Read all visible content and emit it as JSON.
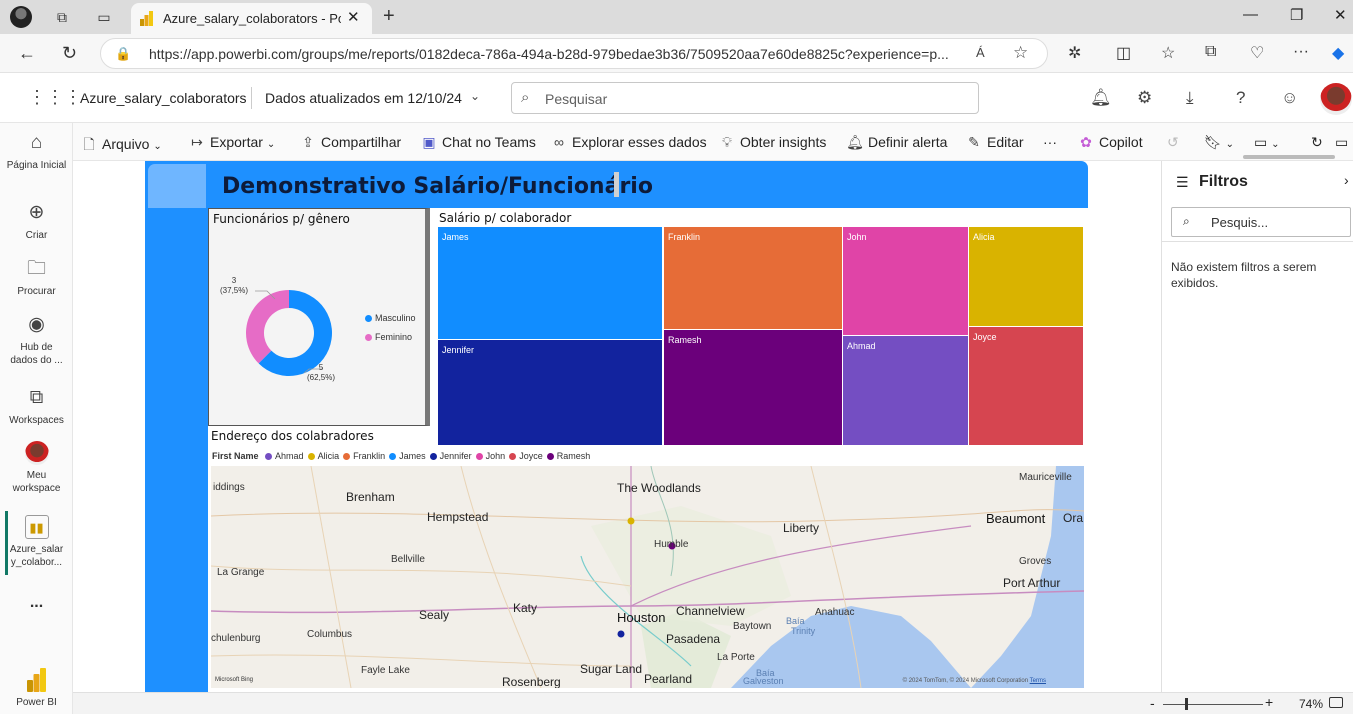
{
  "browser": {
    "tab_title": "Azure_salary_colaborators - Power BI",
    "url": "https://app.powerbi.com/groups/me/reports/0182deca-786a-494a-b28d-979bedae3b36/7509520aa7e60de8825c?experience=p...",
    "read_aloud": "Á"
  },
  "header": {
    "workspace_name": "Azure_salary_colaborators",
    "updated": "Dados atualizados em 12/10/24",
    "search_placeholder": "Pesquisar"
  },
  "leftnav": {
    "items": [
      {
        "label": "Página Inicial"
      },
      {
        "label": "Criar"
      },
      {
        "label": "Procurar"
      },
      {
        "label": "Hub de dados do ..."
      },
      {
        "label": "Workspaces"
      },
      {
        "label": "Meu workspace"
      },
      {
        "label": "Azure_salar y_colabor..."
      },
      {
        "label": "..."
      }
    ],
    "powerbi_label": "Power BI"
  },
  "toolbar": {
    "arquivo": "Arquivo",
    "exportar": "Exportar",
    "compartilhar": "Compartilhar",
    "chat_teams": "Chat no Teams",
    "explorar": "Explorar esses dados",
    "insights": "Obter insights",
    "alerta": "Definir alerta",
    "editar": "Editar",
    "more": "···",
    "copilot": "Copilot"
  },
  "report": {
    "title": "Demonstrativo Salário/Funcionário",
    "donut_title": "Funcionários p/ gênero",
    "treemap_title": "Salário p/ colaborador",
    "map_title": "Endereço dos colabradores",
    "map_legend_label": "First Name"
  },
  "chart_data": [
    {
      "type": "pie",
      "title": "Funcionários p/ gênero",
      "categories": [
        "Masculino",
        "Feminino"
      ],
      "values": [
        5,
        3
      ],
      "percent_labels": [
        "(62,5%)",
        "(37,5%)"
      ],
      "colors": [
        "#118dff",
        "#e66cc6"
      ],
      "legend": "right"
    },
    {
      "type": "treemap",
      "title": "Salário p/ colaborador",
      "categories": [
        "James",
        "Jennifer",
        "Franklin",
        "Ramesh",
        "John",
        "Ahmad",
        "Alicia",
        "Joyce"
      ],
      "colors": [
        "#118dff",
        "#12239e",
        "#e66c37",
        "#6b007b",
        "#e044a7",
        "#744ec2",
        "#d9b300",
        "#d64550"
      ]
    }
  ],
  "map": {
    "legend": [
      {
        "name": "Ahmad",
        "color": "#744ec2"
      },
      {
        "name": "Alicia",
        "color": "#d9b300"
      },
      {
        "name": "Franklin",
        "color": "#e66c37"
      },
      {
        "name": "James",
        "color": "#118dff"
      },
      {
        "name": "Jennifer",
        "color": "#12239e"
      },
      {
        "name": "John",
        "color": "#e044a7"
      },
      {
        "name": "Joyce",
        "color": "#d64550"
      },
      {
        "name": "Ramesh",
        "color": "#6b007b"
      }
    ],
    "places": [
      "iddings",
      "Brenham",
      "The Woodlands",
      "Mauriceville",
      "Hempstead",
      "Liberty",
      "Beaumont",
      "Ora",
      "Humble",
      "Bellville",
      "La Grange",
      "Groves",
      "Port Arthur",
      "Sealy",
      "Katy",
      "Channelview",
      "Houston",
      "Anahuac",
      "Trinity",
      "Baytown",
      "Columbus",
      "Pasadena",
      "chulenburg",
      "La Porte",
      "Sugar Land",
      "Fayle Lake",
      "Galveston",
      "Rosenberg",
      "Pearland"
    ],
    "bay_word": "Baía",
    "copyright": "© 2024 TomTom, © 2024 Microsoft Corporation",
    "terms": "Terms",
    "bing": "Microsoft Bing"
  },
  "filters": {
    "title": "Filtros",
    "search_placeholder": "Pesquis...",
    "empty": "Não existem filtros a serem exibidos."
  },
  "status": {
    "zoom": "74%"
  }
}
